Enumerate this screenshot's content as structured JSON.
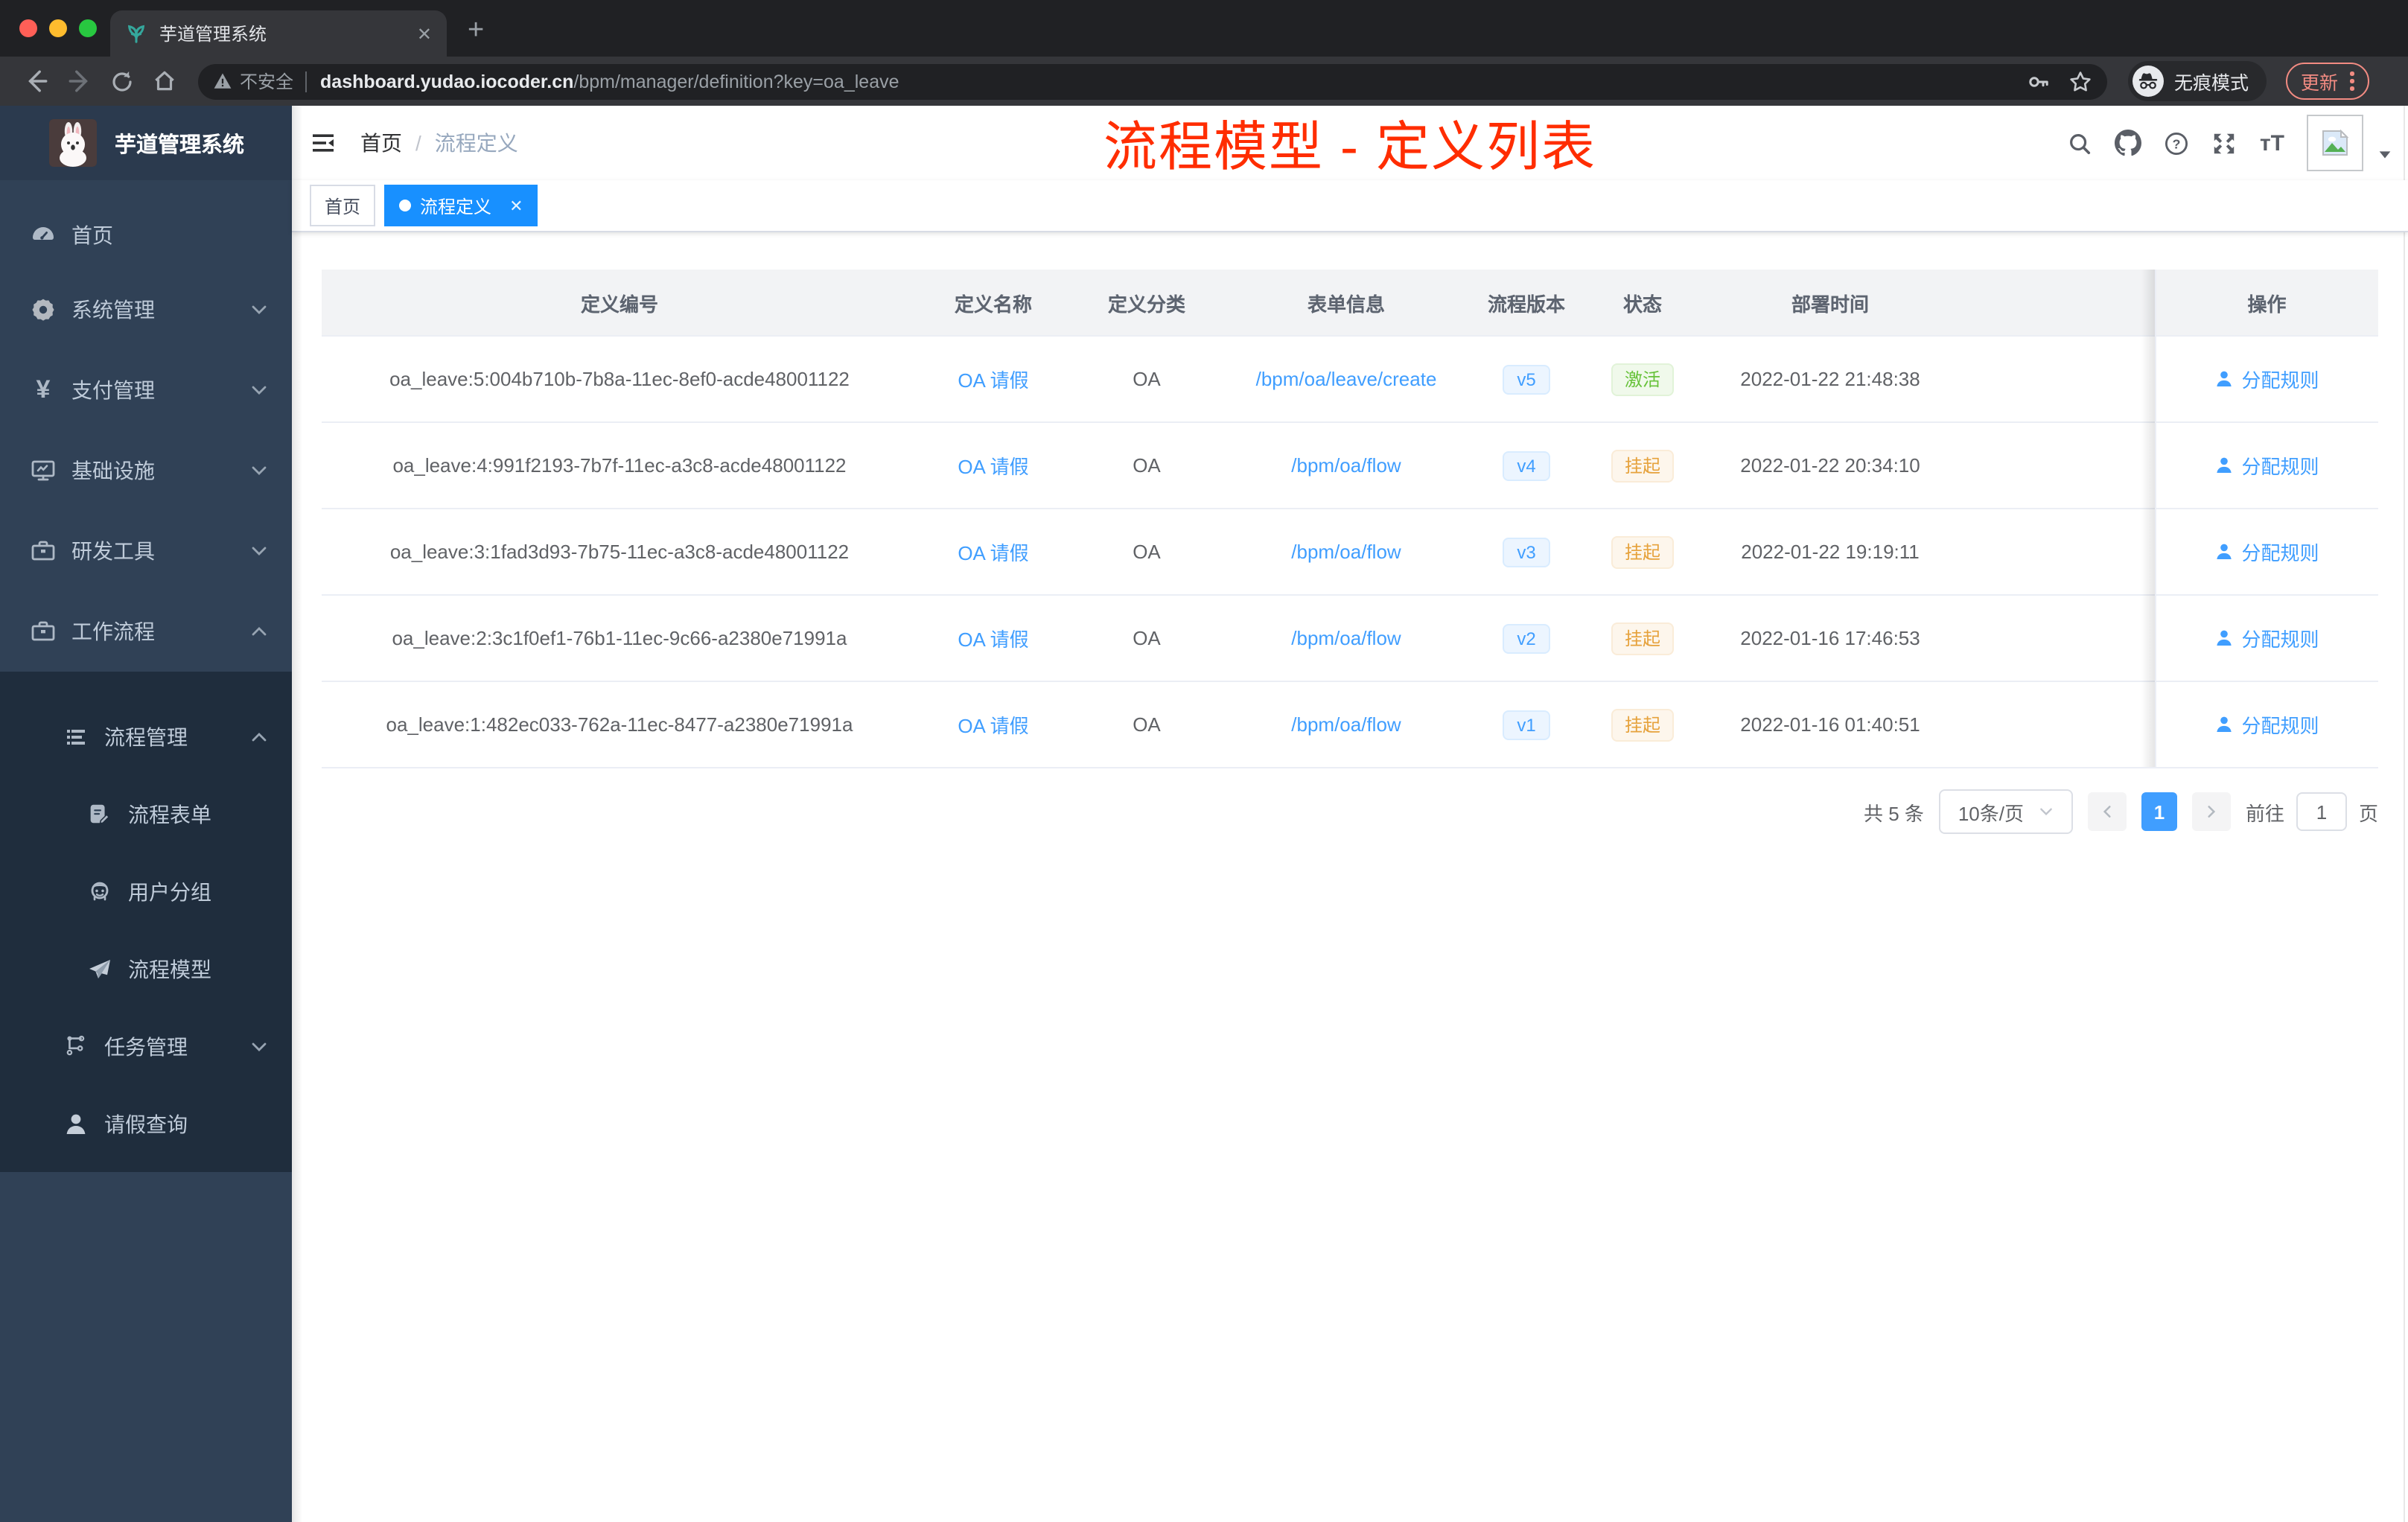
{
  "browser": {
    "tab_title": "芋道管理系统",
    "security_label": "不安全",
    "url_domain": "dashboard.yudao.iocoder.cn",
    "url_path": "/bpm/manager/definition?key=oa_leave",
    "incognito_label": "无痕模式",
    "update_label": "更新"
  },
  "sidebar": {
    "app_title": "芋道管理系统",
    "items": [
      {
        "label": "首页",
        "icon": "dashboard-gauge-icon"
      },
      {
        "label": "系统管理",
        "icon": "gear-icon",
        "arrow": "down"
      },
      {
        "label": "支付管理",
        "icon": "yen-icon",
        "arrow": "down"
      },
      {
        "label": "基础设施",
        "icon": "monitor-icon",
        "arrow": "down"
      },
      {
        "label": "研发工具",
        "icon": "toolbox-icon",
        "arrow": "down"
      },
      {
        "label": "工作流程",
        "icon": "briefcase-icon",
        "arrow": "up"
      },
      {
        "label": "流程管理",
        "icon": "list-icon",
        "arrow": "up"
      },
      {
        "label": "流程表单",
        "icon": "form-edit-icon"
      },
      {
        "label": "用户分组",
        "icon": "people-icon"
      },
      {
        "label": "流程模型",
        "icon": "paper-plane-icon"
      },
      {
        "label": "任务管理",
        "icon": "tree-icon",
        "arrow": "down"
      },
      {
        "label": "请假查询",
        "icon": "person-icon"
      }
    ]
  },
  "header": {
    "breadcrumb": {
      "home": "首页",
      "current": "流程定义"
    },
    "annotation": "流程模型 - 定义列表"
  },
  "tags": [
    {
      "label": "首页",
      "active": false
    },
    {
      "label": "流程定义",
      "active": true
    }
  ],
  "table": {
    "columns": [
      "定义编号",
      "定义名称",
      "定义分类",
      "表单信息",
      "流程版本",
      "状态",
      "部署时间",
      "操作"
    ],
    "rows": [
      {
        "id": "oa_leave:5:004b710b-7b8a-11ec-8ef0-acde48001122",
        "name": "OA 请假",
        "category": "OA",
        "form": "/bpm/oa/leave/create",
        "version": "v5",
        "status": "激活",
        "status_type": "active",
        "time": "2022-01-22 21:48:38",
        "action": "分配规则"
      },
      {
        "id": "oa_leave:4:991f2193-7b7f-11ec-a3c8-acde48001122",
        "name": "OA 请假",
        "category": "OA",
        "form": "/bpm/oa/flow",
        "version": "v4",
        "status": "挂起",
        "status_type": "suspended",
        "time": "2022-01-22 20:34:10",
        "action": "分配规则"
      },
      {
        "id": "oa_leave:3:1fad3d93-7b75-11ec-a3c8-acde48001122",
        "name": "OA 请假",
        "category": "OA",
        "form": "/bpm/oa/flow",
        "version": "v3",
        "status": "挂起",
        "status_type": "suspended",
        "time": "2022-01-22 19:19:11",
        "action": "分配规则"
      },
      {
        "id": "oa_leave:2:3c1f0ef1-76b1-11ec-9c66-a2380e71991a",
        "name": "OA 请假",
        "category": "OA",
        "form": "/bpm/oa/flow",
        "version": "v2",
        "status": "挂起",
        "status_type": "suspended",
        "time": "2022-01-16 17:46:53",
        "action": "分配规则"
      },
      {
        "id": "oa_leave:1:482ec033-762a-11ec-8477-a2380e71991a",
        "name": "OA 请假",
        "category": "OA",
        "form": "/bpm/oa/flow",
        "version": "v1",
        "status": "挂起",
        "status_type": "suspended",
        "time": "2022-01-16 01:40:51",
        "action": "分配规则"
      }
    ]
  },
  "pagination": {
    "total": "共 5 条",
    "page_size": "10条/页",
    "current": "1",
    "goto_label": "前往",
    "goto_value": "1",
    "page_unit": "页"
  },
  "icons": {
    "favicon": "sprout-plant",
    "toolbar": [
      "back-arrow",
      "forward-arrow",
      "reload",
      "home"
    ],
    "url": [
      "warning-triangle",
      "key",
      "star"
    ],
    "header_right": [
      "search",
      "github",
      "help-circle",
      "fullscreen",
      "font-size",
      "broken-image-avatar",
      "caret-down"
    ]
  },
  "colors": {
    "sidebar_bg": "#304156",
    "submenu_bg": "#1f2d3d",
    "tag_active": "#1890ff",
    "primary": "#409eff",
    "status_active": "#67c23a",
    "status_suspended": "#e6a23c",
    "annotation_red": "#ff2d00"
  }
}
